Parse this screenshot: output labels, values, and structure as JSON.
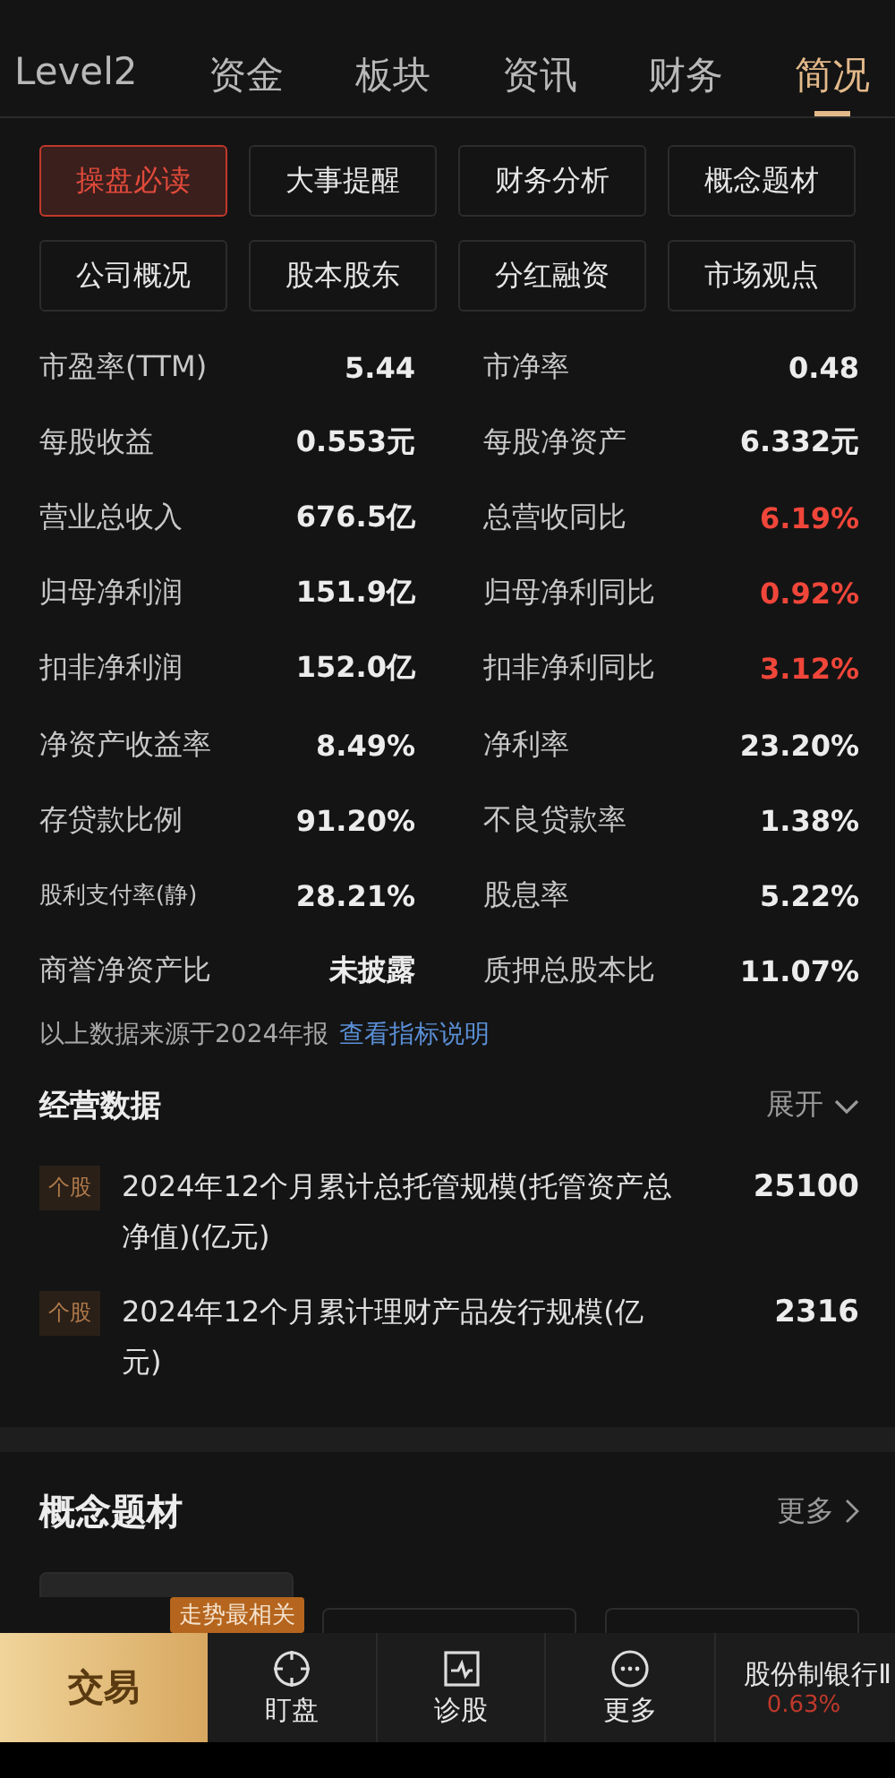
{
  "tabs": [
    {
      "label": "Level2",
      "selected": false
    },
    {
      "label": "资金",
      "selected": false
    },
    {
      "label": "板块",
      "selected": false
    },
    {
      "label": "资讯",
      "selected": false
    },
    {
      "label": "财务",
      "selected": false
    },
    {
      "label": "简况",
      "selected": true
    }
  ],
  "shortcuts": [
    {
      "label": "操盘必读",
      "selected": true
    },
    {
      "label": "大事提醒",
      "selected": false
    },
    {
      "label": "财务分析",
      "selected": false
    },
    {
      "label": "概念题材",
      "selected": false
    },
    {
      "label": "公司概况",
      "selected": false
    },
    {
      "label": "股本股东",
      "selected": false
    },
    {
      "label": "分红融资",
      "selected": false
    },
    {
      "label": "市场观点",
      "selected": false
    }
  ],
  "metrics": [
    {
      "label": "市盈率(TTM)",
      "value": "5.44",
      "up": false,
      "compact": false
    },
    {
      "label": "市净率",
      "value": "0.48",
      "up": false,
      "compact": false
    },
    {
      "label": "每股收益",
      "value": "0.553元",
      "up": false,
      "compact": false
    },
    {
      "label": "每股净资产",
      "value": "6.332元",
      "up": false,
      "compact": false
    },
    {
      "label": "营业总收入",
      "value": "676.5亿",
      "up": false,
      "compact": false
    },
    {
      "label": "总营收同比",
      "value": "6.19%",
      "up": true,
      "compact": false
    },
    {
      "label": "归母净利润",
      "value": "151.9亿",
      "up": false,
      "compact": false
    },
    {
      "label": "归母净利同比",
      "value": "0.92%",
      "up": true,
      "compact": false
    },
    {
      "label": "扣非净利润",
      "value": "152.0亿",
      "up": false,
      "compact": false
    },
    {
      "label": "扣非净利同比",
      "value": "3.12%",
      "up": true,
      "compact": false
    },
    {
      "label": "净资产收益率",
      "value": "8.49%",
      "up": false,
      "compact": false
    },
    {
      "label": "净利率",
      "value": "23.20%",
      "up": false,
      "compact": false
    },
    {
      "label": "存贷款比例",
      "value": "91.20%",
      "up": false,
      "compact": false
    },
    {
      "label": "不良贷款率",
      "value": "1.38%",
      "up": false,
      "compact": false
    },
    {
      "label": "股利支付率(静)",
      "value": "28.21%",
      "up": false,
      "compact": true
    },
    {
      "label": "股息率",
      "value": "5.22%",
      "up": false,
      "compact": false
    },
    {
      "label": "商誉净资产比",
      "value": "未披露",
      "up": false,
      "compact": false
    },
    {
      "label": "质押总股本比",
      "value": "11.07%",
      "up": false,
      "compact": false
    }
  ],
  "source_note": {
    "text": "以上数据来源于2024年报",
    "link": "查看指标说明"
  },
  "operations": {
    "title": "经营数据",
    "toggle": "展开",
    "expanded": false,
    "items": [
      {
        "tag": "个股",
        "label": "2024年12个月累计总托管规模(托管资产总净值)(亿元)",
        "value": "25100"
      },
      {
        "tag": "个股",
        "label": "2024年12个月累计理财产品发行规模(亿元)",
        "value": "2316"
      }
    ]
  },
  "concepts": {
    "title": "概念题材",
    "more": "更多",
    "badge": "走势最相关"
  },
  "bottom_bar": {
    "trade": "交易",
    "items": [
      {
        "kind": "target",
        "label": "盯盘"
      },
      {
        "kind": "pulse",
        "label": "诊股"
      },
      {
        "kind": "more",
        "label": "更多"
      }
    ],
    "ticker": {
      "name": "股份制银行Ⅱ",
      "change": "0.63%"
    }
  }
}
